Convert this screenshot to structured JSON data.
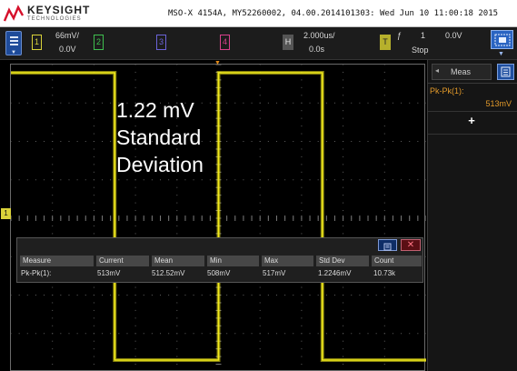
{
  "brand": {
    "name": "KEYSIGHT",
    "subtitle": "TECHNOLOGIES"
  },
  "status_line": "MSO-X 4154A, MY52260002, 04.00.2014101303: Wed Jun 10 11:00:18 2015",
  "channels": [
    {
      "number": "1",
      "scale": "66mV/",
      "offset": "0.0V",
      "color": "#d9d23a"
    },
    {
      "number": "2",
      "color": "#3fbf4f"
    },
    {
      "number": "3",
      "color": "#6b63d8"
    },
    {
      "number": "4",
      "color": "#d8408c"
    }
  ],
  "horizontal": {
    "tag": "H",
    "timebase": "2.000us/",
    "delay": "0.0s"
  },
  "trigger": {
    "tag": "T",
    "source": "1",
    "level": "0.0V",
    "mode": "Stop"
  },
  "ground_marker": "1",
  "annotation": {
    "line1": "1.22 mV",
    "line2": "Standard",
    "line3": "Deviation"
  },
  "measurements": {
    "headers": [
      "Measure",
      "Current",
      "Mean",
      "Min",
      "Max",
      "Std Dev",
      "Count"
    ],
    "row": [
      "Pk-Pk(1):",
      "513mV",
      "512.52mV",
      "508mV",
      "517mV",
      "1.2246mV",
      "10.73k"
    ],
    "close_label": "✕"
  },
  "sidebar": {
    "tab_label": "Meas",
    "measurement_name": "Pk-Pk(1):",
    "measurement_value": "513mV",
    "add_label": "+"
  },
  "colors": {
    "trace": "#f2ea1c",
    "measurement_highlight": "#e39a2a",
    "accent_blue": "#2a64c2"
  }
}
